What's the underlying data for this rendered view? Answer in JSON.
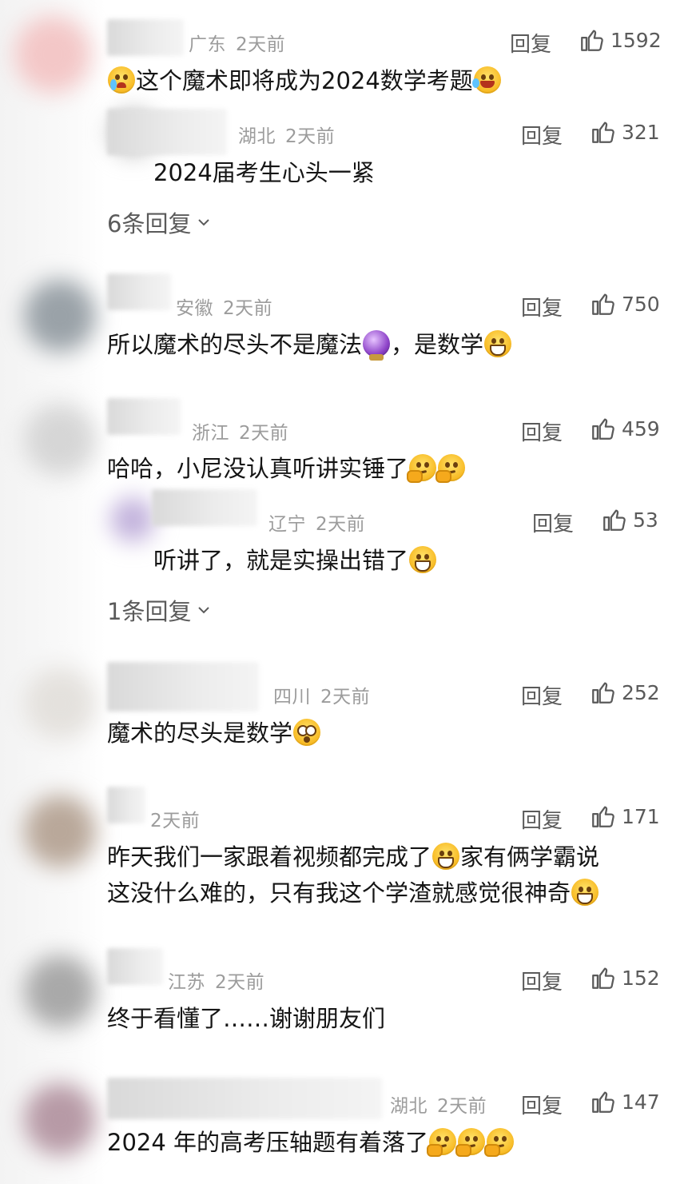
{
  "reply_label": "回复",
  "comments": [
    {
      "location": "广东",
      "time": "2天前",
      "likes": "1592",
      "text_before": "",
      "text_after": "这个魔术即将成为2024数学考题",
      "emoji_pre": "cry-icon",
      "emoji_post": "laugh-icon"
    },
    {
      "location": "湖北",
      "time": "2天前",
      "likes": "321",
      "text": "2024届考生心头一紧",
      "is_reply": true
    },
    {
      "expand": "6条回复"
    },
    {
      "location": "安徽",
      "time": "2天前",
      "likes": "750",
      "text_a": "所以魔术的尽头不是魔法",
      "text_b": "，是数学"
    },
    {
      "location": "浙江",
      "time": "2天前",
      "likes": "459",
      "text": "哈哈，小尼没认真听讲实锤了"
    },
    {
      "location": "辽宁",
      "time": "2天前",
      "likes": "53",
      "text": "听讲了，就是实操出错了",
      "is_reply": true
    },
    {
      "expand": "1条回复"
    },
    {
      "location": "四川",
      "time": "2天前",
      "likes": "252",
      "text": "魔术的尽头是数学"
    },
    {
      "location": "",
      "time": "2天前",
      "likes": "171",
      "line1": "昨天我们一家跟着视频都完成了",
      "line1b": "家有俩学霸说",
      "line2": "这没什么难的，只有我这个学渣就感觉很神奇"
    },
    {
      "location": "江苏",
      "time": "2天前",
      "likes": "152",
      "text": "终于看懂了……谢谢朋友们"
    },
    {
      "location": "湖北",
      "time": "2天前",
      "likes": "147",
      "text": "2024 年的高考压轴题有着落了"
    }
  ]
}
